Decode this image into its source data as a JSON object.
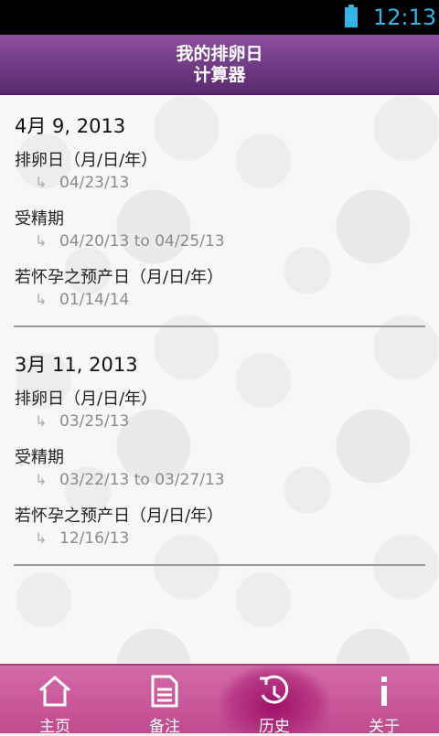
{
  "status_bar": {
    "time": "12:13"
  },
  "title_bar": {
    "line1": "我的排卵日",
    "line2": "计算器"
  },
  "history": [
    {
      "date": "4月 9, 2013",
      "ovulation_label": "排卵日（月/日/年）",
      "ovulation_value": "04/23/13",
      "fertile_label": "受精期",
      "fertile_value": "04/20/13 to 04/25/13",
      "due_label": "若怀孕之预产日（月/日/年）",
      "due_value": "01/14/14"
    },
    {
      "date": "3月 11, 2013",
      "ovulation_label": "排卵日（月/日/年）",
      "ovulation_value": "03/25/13",
      "fertile_label": "受精期",
      "fertile_value": "03/22/13 to 03/27/13",
      "due_label": "若怀孕之预产日（月/日/年）",
      "due_value": "12/16/13"
    }
  ],
  "arrow_glyph": "↳",
  "bottom_nav": {
    "items": [
      {
        "label": "主页",
        "icon": "home-icon"
      },
      {
        "label": "备注",
        "icon": "notes-icon"
      },
      {
        "label": "历史",
        "icon": "history-icon",
        "active": true
      },
      {
        "label": "关于",
        "icon": "info-icon"
      }
    ]
  }
}
